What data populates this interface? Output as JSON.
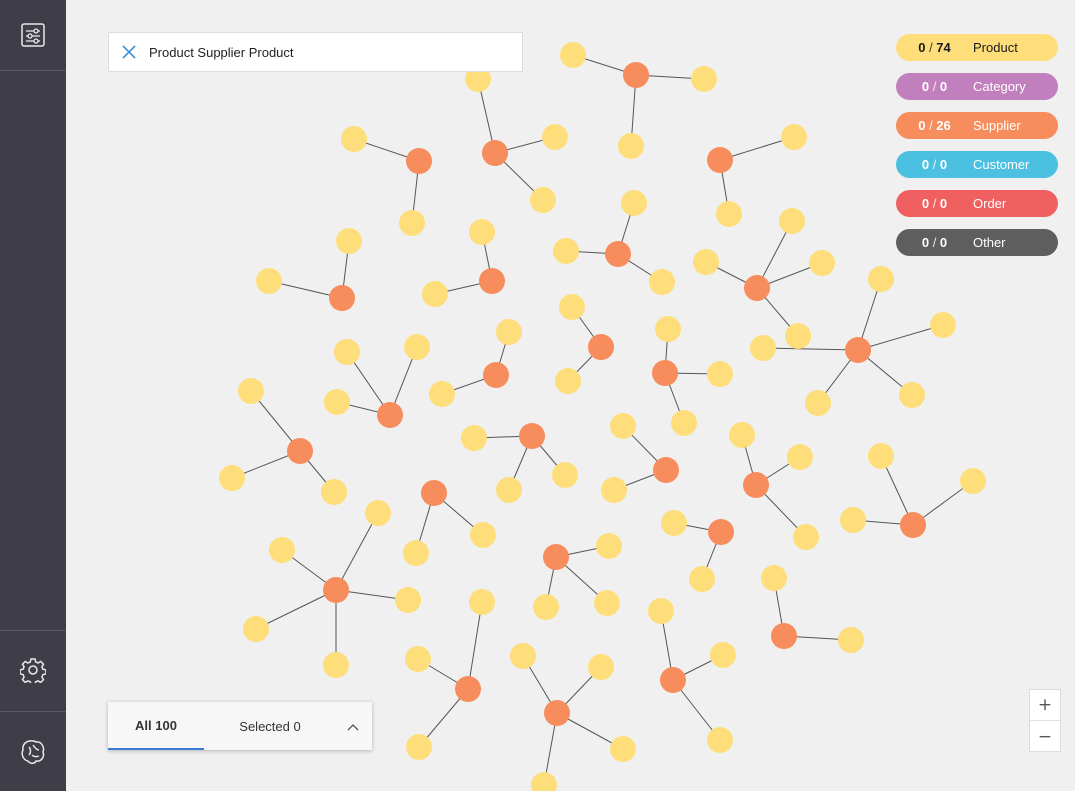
{
  "search": {
    "query": "Product Supplier Product"
  },
  "legend": [
    {
      "selected": "0",
      "total": "74",
      "label": "Product",
      "color": "#fede7a",
      "text": "#1a1a1a"
    },
    {
      "selected": "0",
      "total": "0",
      "label": "Category",
      "color": "#c180bd",
      "text": "#ffffff"
    },
    {
      "selected": "0",
      "total": "26",
      "label": "Supplier",
      "color": "#f78c5c",
      "text": "#ffffff"
    },
    {
      "selected": "0",
      "total": "0",
      "label": "Customer",
      "color": "#4bc0e0",
      "text": "#ffffff"
    },
    {
      "selected": "0",
      "total": "0",
      "label": "Order",
      "color": "#f06060",
      "text": "#ffffff"
    },
    {
      "selected": "0",
      "total": "0",
      "label": "Other",
      "color": "#5e5e5e",
      "text": "#ffffff"
    }
  ],
  "bottom": {
    "all_label": "All 100",
    "selected_label": "Selected 0"
  },
  "zoom": {
    "in": "+",
    "out": "−"
  },
  "colors": {
    "sidebar": "#3f3d47",
    "product_node": "#fede7a",
    "supplier_node": "#f78c5c",
    "edge": "#555555",
    "accent": "#3d7ad6"
  },
  "icons": [
    "sliders-icon",
    "gear-icon",
    "brain-icon",
    "close-icon",
    "chevron-up-icon"
  ]
}
